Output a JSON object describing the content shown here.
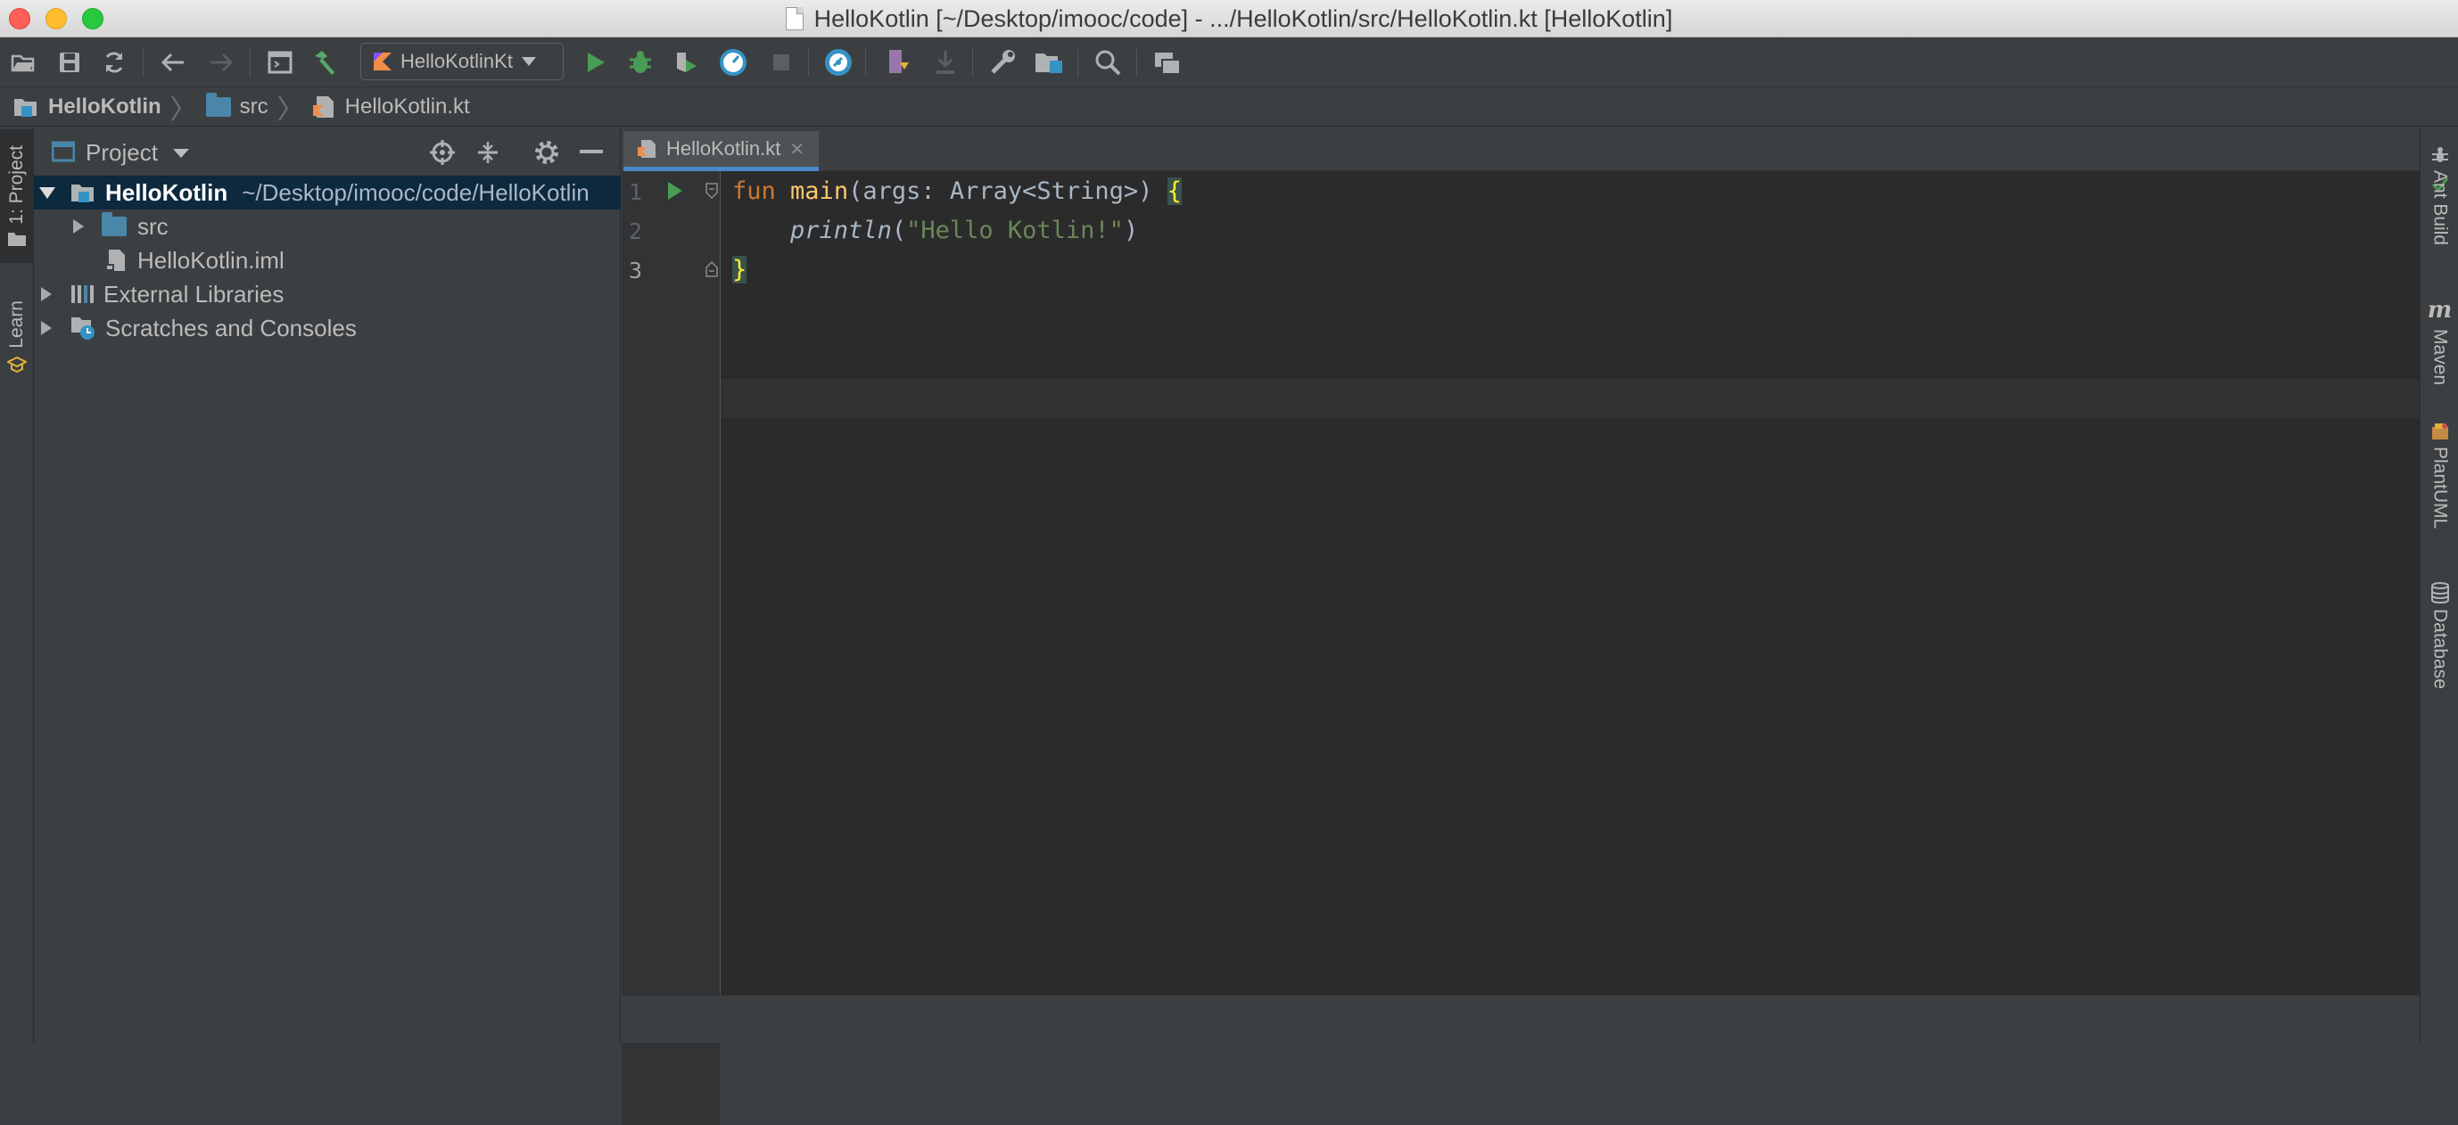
{
  "window": {
    "title": "HelloKotlin [~/Desktop/imooc/code] - .../HelloKotlin/src/HelloKotlin.kt [HelloKotlin]"
  },
  "toolbar": {
    "run_config": "HelloKotlinKt",
    "icons": [
      "open-folder-icon",
      "save-icon",
      "sync-icon",
      "back-icon",
      "forward-icon",
      "terminal-icon",
      "build-hammer-icon",
      "run-icon",
      "debug-icon",
      "coverage-icon",
      "profile-icon",
      "stop-icon",
      "help-search-icon",
      "vcs-update-icon",
      "vcs-commit-icon",
      "settings-wrench-icon",
      "project-structure-icon",
      "search-icon",
      "sdk-manager-icon"
    ]
  },
  "breadcrumb": {
    "items": [
      "HelloKotlin",
      "src",
      "HelloKotlin.kt"
    ]
  },
  "left_stripe": {
    "tabs": [
      "1: Project",
      "Learn"
    ]
  },
  "project_panel": {
    "title": "Project",
    "tree": [
      {
        "label": "HelloKotlin",
        "path": "~/Desktop/imooc/code/HelloKotlin",
        "expanded": true
      },
      {
        "label": "src",
        "expanded": false
      },
      {
        "label": "HelloKotlin.iml"
      },
      {
        "label": "External Libraries",
        "expanded": false
      },
      {
        "label": "Scratches and Consoles",
        "expanded": false
      }
    ]
  },
  "editor": {
    "tab_label": "HelloKotlin.kt",
    "line_numbers": [
      "1",
      "2",
      "3"
    ],
    "lines": [
      {
        "kw": "fun",
        "fn": "main",
        "rest": "(args: Array<String>) ",
        "brace": "{"
      },
      {
        "indent": "    ",
        "call": "println",
        "open": "(",
        "str": "\"Hello Kotlin!\"",
        "close": ")"
      },
      {
        "brace": "}"
      }
    ]
  },
  "right_stripe": {
    "tabs": [
      "Ant Build",
      "Maven",
      "PlantUML",
      "Database"
    ]
  }
}
